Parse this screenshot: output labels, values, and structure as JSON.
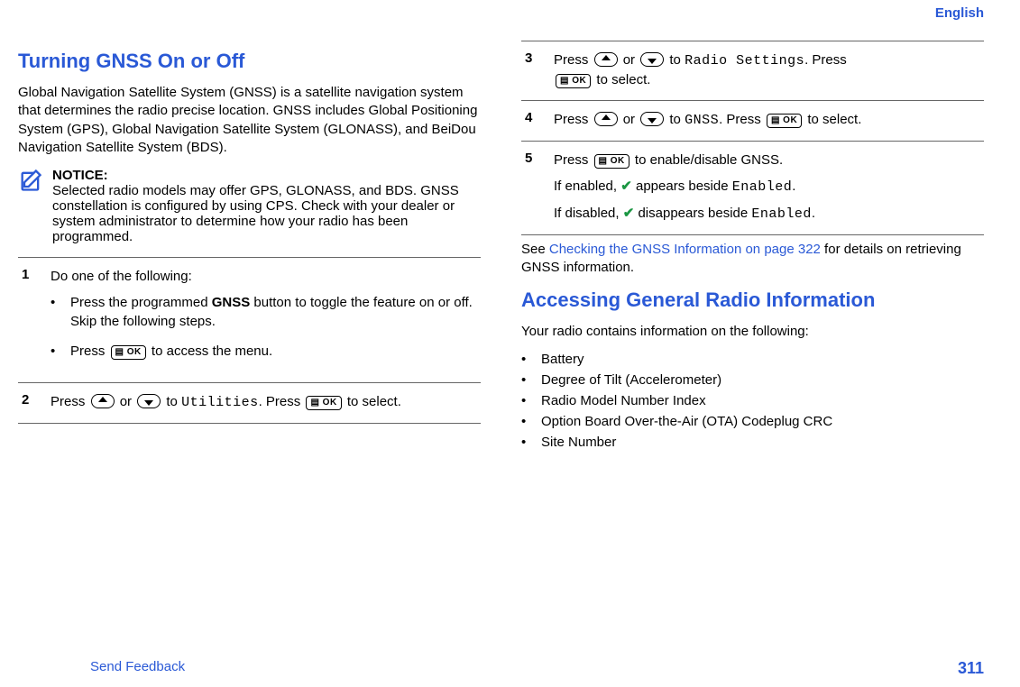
{
  "lang_label": "English",
  "col1": {
    "heading": "Turning GNSS On or Off",
    "intro": "Global Navigation Satellite System (GNSS) is a satellite navigation system that determines the radio precise location. GNSS includes Global Positioning System (GPS), Global Navigation Satellite System (GLONASS), and BeiDou Navigation Satellite System (BDS).",
    "notice_label": "NOTICE:",
    "notice_body": "Selected radio models may offer GPS, GLONASS, and BDS. GNSS constellation is configured by using CPS. Check with your dealer or system administrator to determine how your radio has been programmed.",
    "step1_num": "1",
    "step1_lead": "Do one of the following:",
    "step1_bullet1_a": "Press the programmed ",
    "step1_bullet1_bold": "GNSS",
    "step1_bullet1_b": " button to toggle the feature on or off. Skip the following steps.",
    "step1_bullet2_a": "Press ",
    "step1_bullet2_b": " to access the menu.",
    "step2_num": "2",
    "step2_a": "Press ",
    "step2_b": " or ",
    "step2_c": " to ",
    "step2_mono": "Utilities",
    "step2_d": ". Press ",
    "step2_e": " to select.",
    "ok_label": "▤ OK"
  },
  "col2": {
    "step3_num": "3",
    "step3_a": "Press ",
    "step3_b": " or ",
    "step3_c": " to ",
    "step3_mono": "Radio Settings",
    "step3_d": ". Press ",
    "step3_e": " to select.",
    "step4_num": "4",
    "step4_a": "Press ",
    "step4_b": " or ",
    "step4_c": " to ",
    "step4_mono": "GNSS",
    "step4_d": ". Press ",
    "step4_e": " to select.",
    "step5_num": "5",
    "step5_a": "Press ",
    "step5_b": " to enable/disable GNSS.",
    "step5_enabled_a": "If enabled, ",
    "step5_enabled_b": " appears beside ",
    "step5_enabled_mono": "Enabled",
    "step5_enabled_c": ".",
    "step5_disabled_a": "If disabled, ",
    "step5_disabled_b": " disappears beside ",
    "step5_disabled_mono": "Enabled",
    "step5_disabled_c": ".",
    "outro_a": "See ",
    "outro_link": "Checking the GNSS Information on page 322",
    "outro_b": " for details on retrieving GNSS information.",
    "heading2": "Accessing General Radio Information",
    "heading2_lead": "Your radio contains information on the following:",
    "bullets": [
      "Battery",
      "Degree of Tilt (Accelerometer)",
      "Radio Model Number Index",
      "Option Board Over-the-Air (OTA) Codeplug CRC",
      "Site Number"
    ],
    "check_glyph": "✔"
  },
  "footer": {
    "feedback": "Send Feedback",
    "page": "311"
  }
}
